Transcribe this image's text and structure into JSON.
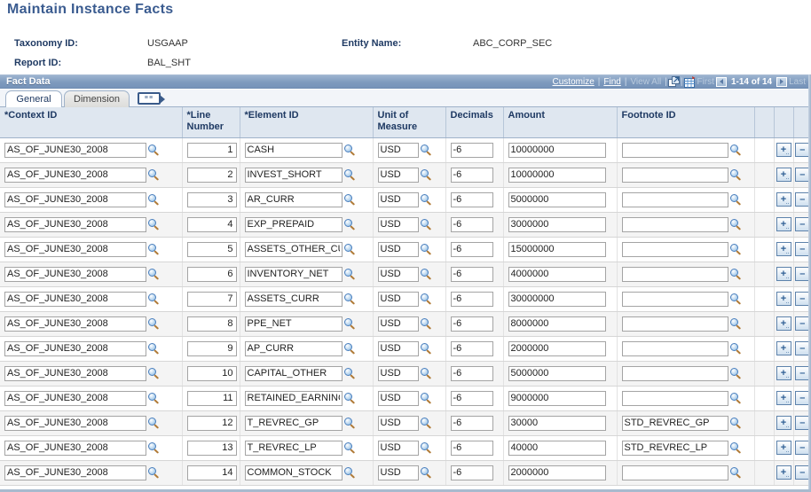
{
  "page": {
    "title": "Maintain Instance Facts",
    "title_color": "#3b5c90"
  },
  "header": {
    "taxonomy_label": "Taxonomy ID:",
    "taxonomy_value": "USGAAP",
    "entity_label": "Entity Name:",
    "entity_value": "ABC_CORP_SEC",
    "report_label": "Report ID:",
    "report_value": "BAL_SHT"
  },
  "group_box": {
    "title": "Fact Data",
    "bar_color": "#7e9abe",
    "tools": {
      "customize": "Customize",
      "find": "Find",
      "view_all": "View All",
      "zoom_window_icon": "new-window-icon",
      "download_grid_icon": "download-to-spreadsheet-icon",
      "first_label": "First",
      "prev_icon": "previous-page-arrow-icon",
      "range": "1-14 of 14",
      "next_icon": "next-page-arrow-icon",
      "last_label": "Last"
    }
  },
  "tabs": [
    {
      "label": "General",
      "active": true
    },
    {
      "label": "Dimension",
      "active": false
    }
  ],
  "tab_extra_icon": "show-all-columns-icon",
  "grid": {
    "columns": [
      {
        "key": "context_id",
        "label": "*Context ID"
      },
      {
        "key": "line_number",
        "label": "*Line Number"
      },
      {
        "key": "element_id",
        "label": "*Element ID"
      },
      {
        "key": "unit_of_measure",
        "label": "Unit of Measure"
      },
      {
        "key": "decimals",
        "label": "Decimals"
      },
      {
        "key": "amount",
        "label": "Amount"
      },
      {
        "key": "footnote_id",
        "label": "Footnote ID"
      }
    ],
    "add_button_label": "+",
    "add_button_dots": "..",
    "delete_button_label": "–",
    "rows": [
      {
        "context_id": "AS_OF_JUNE30_2008",
        "line_number": "1",
        "element_id": "CASH",
        "unit_of_measure": "USD",
        "decimals": "-6",
        "amount": "10000000",
        "footnote_id": ""
      },
      {
        "context_id": "AS_OF_JUNE30_2008",
        "line_number": "2",
        "element_id": "INVEST_SHORT",
        "unit_of_measure": "USD",
        "decimals": "-6",
        "amount": "10000000",
        "footnote_id": ""
      },
      {
        "context_id": "AS_OF_JUNE30_2008",
        "line_number": "3",
        "element_id": "AR_CURR",
        "unit_of_measure": "USD",
        "decimals": "-6",
        "amount": "5000000",
        "footnote_id": ""
      },
      {
        "context_id": "AS_OF_JUNE30_2008",
        "line_number": "4",
        "element_id": "EXP_PREPAID",
        "unit_of_measure": "USD",
        "decimals": "-6",
        "amount": "3000000",
        "footnote_id": ""
      },
      {
        "context_id": "AS_OF_JUNE30_2008",
        "line_number": "5",
        "element_id": "ASSETS_OTHER_CU",
        "unit_of_measure": "USD",
        "decimals": "-6",
        "amount": "15000000",
        "footnote_id": ""
      },
      {
        "context_id": "AS_OF_JUNE30_2008",
        "line_number": "6",
        "element_id": "INVENTORY_NET",
        "unit_of_measure": "USD",
        "decimals": "-6",
        "amount": "4000000",
        "footnote_id": ""
      },
      {
        "context_id": "AS_OF_JUNE30_2008",
        "line_number": "7",
        "element_id": "ASSETS_CURR",
        "unit_of_measure": "USD",
        "decimals": "-6",
        "amount": "30000000",
        "footnote_id": ""
      },
      {
        "context_id": "AS_OF_JUNE30_2008",
        "line_number": "8",
        "element_id": "PPE_NET",
        "unit_of_measure": "USD",
        "decimals": "-6",
        "amount": "8000000",
        "footnote_id": ""
      },
      {
        "context_id": "AS_OF_JUNE30_2008",
        "line_number": "9",
        "element_id": "AP_CURR",
        "unit_of_measure": "USD",
        "decimals": "-6",
        "amount": "2000000",
        "footnote_id": ""
      },
      {
        "context_id": "AS_OF_JUNE30_2008",
        "line_number": "10",
        "element_id": "CAPITAL_OTHER",
        "unit_of_measure": "USD",
        "decimals": "-6",
        "amount": "5000000",
        "footnote_id": ""
      },
      {
        "context_id": "AS_OF_JUNE30_2008",
        "line_number": "11",
        "element_id": "RETAINED_EARNING",
        "unit_of_measure": "USD",
        "decimals": "-6",
        "amount": "9000000",
        "footnote_id": ""
      },
      {
        "context_id": "AS_OF_JUNE30_2008",
        "line_number": "12",
        "element_id": "T_REVREC_GP",
        "unit_of_measure": "USD",
        "decimals": "-6",
        "amount": "30000",
        "footnote_id": "STD_REVREC_GP"
      },
      {
        "context_id": "AS_OF_JUNE30_2008",
        "line_number": "13",
        "element_id": "T_REVREC_LP",
        "unit_of_measure": "USD",
        "decimals": "-6",
        "amount": "40000",
        "footnote_id": "STD_REVREC_LP"
      },
      {
        "context_id": "AS_OF_JUNE30_2008",
        "line_number": "14",
        "element_id": "COMMON_STOCK",
        "unit_of_measure": "USD",
        "decimals": "-6",
        "amount": "2000000",
        "footnote_id": ""
      }
    ]
  }
}
